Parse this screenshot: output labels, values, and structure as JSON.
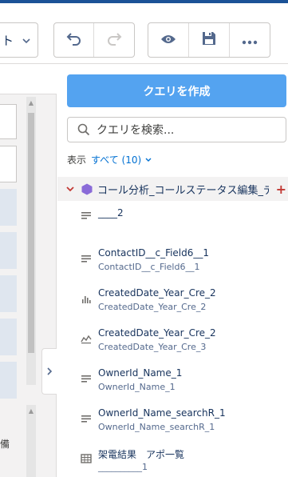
{
  "toolbar": {
    "dropdown_label": "ト",
    "undo_icon": "undo-icon",
    "redo_icon": "redo-icon",
    "preview_icon": "eye-icon",
    "save_icon": "save-icon",
    "more_icon": "more-icon"
  },
  "panel": {
    "create_query_label": "クエリを作成",
    "search_placeholder": "クエリを検索...",
    "filter_prefix": "表示",
    "filter_value": "すべて (10)",
    "group_title": "コール分析_コールステータス編集_デモ",
    "fields": [
      {
        "label": "____2",
        "api": "",
        "icon": "dimension-icon"
      },
      {
        "label": "ContactID__c_Field6__1",
        "api": "ContactID__c_Field6__1",
        "icon": "dimension-icon"
      },
      {
        "label": "CreatedDate_Year_Cre_2",
        "api": "CreatedDate_Year_Cre_2",
        "icon": "bar-chart-icon"
      },
      {
        "label": "CreatedDate_Year_Cre_2",
        "api": "CreatedDate_Year_Cre_3",
        "icon": "line-chart-icon"
      },
      {
        "label": "OwnerId_Name_1",
        "api": "OwnerId_Name_1",
        "icon": "dimension-icon"
      },
      {
        "label": "OwnerId_Name_searchR_1",
        "api": "OwnerId_Name_searchR_1",
        "icon": "dimension-icon"
      },
      {
        "label": "架電結果　アポ一覧",
        "api": "__________1",
        "icon": "table-icon"
      }
    ]
  },
  "canvas": {
    "fragment_text": "備"
  },
  "colors": {
    "brand_blue": "#54a3f0",
    "group_icon": "#8a6bd8",
    "link": "#0070d2"
  }
}
